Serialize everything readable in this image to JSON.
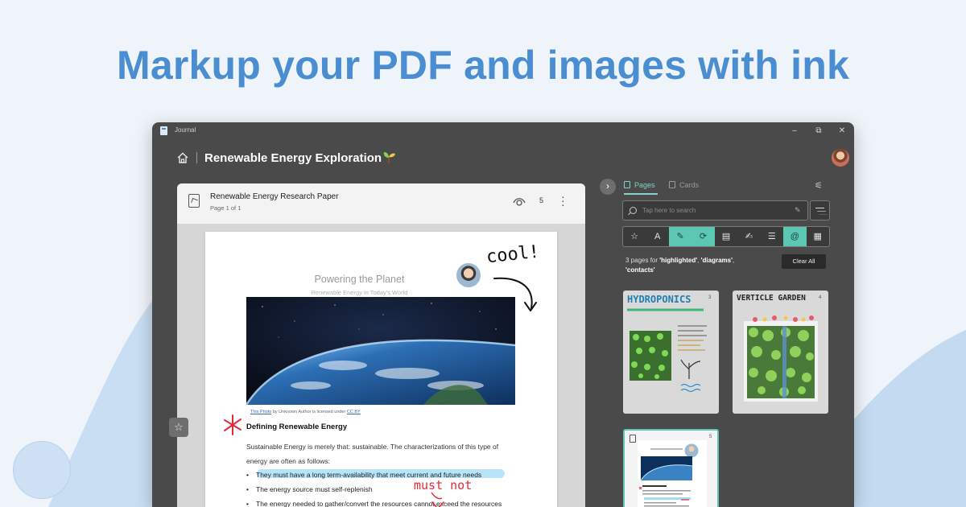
{
  "headline": "Markup your PDF and images with ink",
  "window": {
    "app_name": "Journal",
    "controls": {
      "minimize": "–",
      "maximize": "⧉",
      "close": "✕"
    },
    "notebook_title": "Renewable Energy Exploration"
  },
  "document": {
    "file_name": "Renewable Energy Research Paper",
    "page_info": "Page 1 of 1",
    "view_count": "5",
    "page": {
      "title": "Powering the Planet",
      "subtitle": "Renewable Energy in Today's World",
      "credit": {
        "link1": "This Photo",
        "middle": " by Unknown Author is licensed under ",
        "link2": "CC BY"
      },
      "section_title": "Defining Renewable Energy",
      "body": "Sustainable Energy is merely that: sustainable. The characterizations of this type of energy are often as follows:",
      "bullets": [
        "They must have a long term-availability that meet current and future needs",
        "The energy source must self-replenish",
        "The energy needed to gather/convert the resources cannot exceed the resources"
      ],
      "ink_annotations": [
        "cool!",
        "must not"
      ]
    }
  },
  "sidebar": {
    "tabs": [
      {
        "label": "Pages",
        "active": true
      },
      {
        "label": "Cards",
        "active": false
      }
    ],
    "search_placeholder": "Tap here to search",
    "filter_tools": [
      {
        "icon": "star-icon",
        "glyph": "☆",
        "active": false
      },
      {
        "icon": "text-icon",
        "glyph": "A",
        "active": false
      },
      {
        "icon": "highlighter-icon",
        "glyph": "✎",
        "active": true
      },
      {
        "icon": "diagram-icon",
        "glyph": "⟳",
        "active": true
      },
      {
        "icon": "pdf-icon",
        "glyph": "▤",
        "active": false
      },
      {
        "icon": "form-icon",
        "glyph": "✍",
        "active": false
      },
      {
        "icon": "list-icon",
        "glyph": "☰",
        "active": false
      },
      {
        "icon": "contact-icon",
        "glyph": "@",
        "active": true
      },
      {
        "icon": "calendar-icon",
        "glyph": "▦",
        "active": false
      }
    ],
    "results": {
      "prefix": "3 pages for ",
      "terms": [
        "'highlighted'",
        "'diagrams'",
        "'contacts'"
      ],
      "clear_label": "Clear All"
    },
    "thumbnails": [
      {
        "title": "HYDROPONICS",
        "number": "3"
      },
      {
        "title": "VERTICLE GARDEN",
        "number": "4"
      },
      {
        "title": "",
        "number": "5"
      }
    ]
  },
  "colors": {
    "headline": "#4a8ed1",
    "window_bg": "#4a4a4a",
    "accent": "#5cc7b3",
    "ink_red": "#e02a3a",
    "highlight": "#7dcdf5"
  }
}
